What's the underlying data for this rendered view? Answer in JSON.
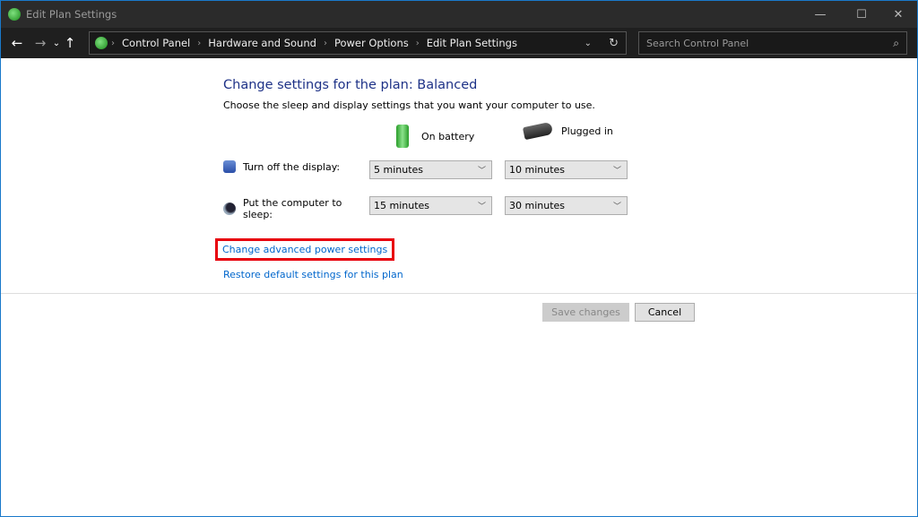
{
  "window": {
    "title": "Edit Plan Settings",
    "minimize": "—",
    "maximize": "☐",
    "close": "✕"
  },
  "nav": {
    "back": "←",
    "forward": "→",
    "recent": "⌄",
    "up": "↑",
    "breadcrumbs": [
      "Control Panel",
      "Hardware and Sound",
      "Power Options",
      "Edit Plan Settings"
    ],
    "refresh": "↻",
    "dropdown": "⌄",
    "search_placeholder": "Search Control Panel",
    "search_icon": "⌕"
  },
  "main": {
    "title": "Change settings for the plan: Balanced",
    "subtitle": "Choose the sleep and display settings that you want your computer to use.",
    "columns": {
      "battery": "On battery",
      "plugged": "Plugged in"
    },
    "rows": [
      {
        "label": "Turn off the display:",
        "battery": "5 minutes",
        "plugged": "10 minutes",
        "icon": "display-icon"
      },
      {
        "label": "Put the computer to sleep:",
        "battery": "15 minutes",
        "plugged": "30 minutes",
        "icon": "sleep-icon"
      }
    ],
    "links": {
      "advanced": "Change advanced power settings",
      "restore": "Restore default settings for this plan"
    },
    "buttons": {
      "save": "Save changes",
      "cancel": "Cancel"
    },
    "highlight_color": "#e8000b"
  }
}
